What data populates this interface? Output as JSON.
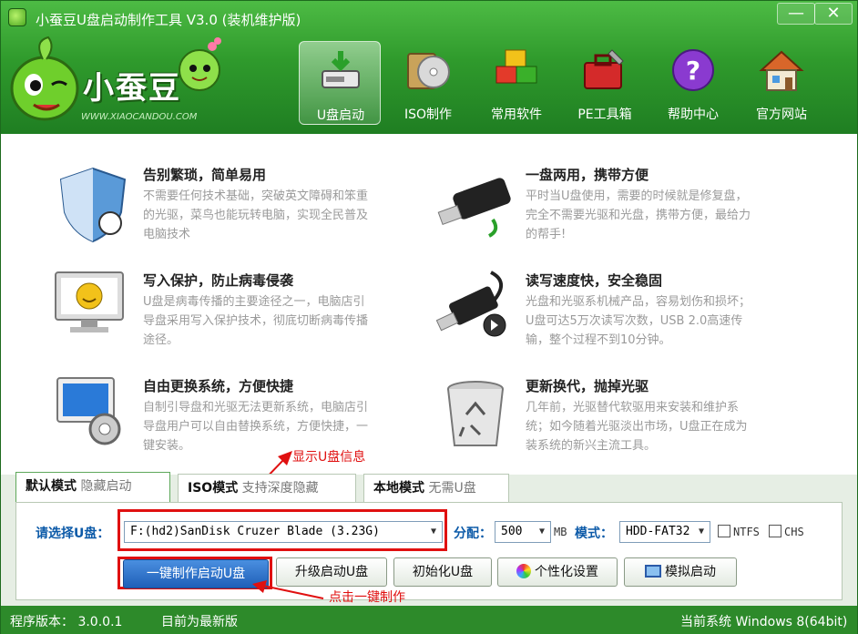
{
  "window": {
    "title": "小蚕豆U盘启动制作工具 V3.0 (装机维护版)",
    "minimize": "—",
    "close": "✕"
  },
  "logo": {
    "text": "小蚕豆",
    "url": "WWW.XIAOCANDOU.COM"
  },
  "nav": [
    {
      "label": "U盘启动",
      "icon": "usb-drive-icon"
    },
    {
      "label": "ISO制作",
      "icon": "iso-disc-icon"
    },
    {
      "label": "常用软件",
      "icon": "software-cubes-icon"
    },
    {
      "label": "PE工具箱",
      "icon": "toolbox-icon"
    },
    {
      "label": "帮助中心",
      "icon": "help-icon"
    },
    {
      "label": "官方网站",
      "icon": "home-icon"
    }
  ],
  "features": [
    {
      "title": "告别繁琐，简单易用",
      "desc": "不需要任何技术基础，突破英文障碍和笨重的光驱，菜鸟也能玩转电脑，实现全民普及电脑技术",
      "icon": "shield-icon"
    },
    {
      "title": "一盘两用，携带方便",
      "desc": "平时当U盘使用，需要的时候就是修复盘，完全不需要光驱和光盘，携带方便，最给力的帮手!",
      "icon": "usb-stick-icon"
    },
    {
      "title": "写入保护，防止病毒侵袭",
      "desc": "U盘是病毒传播的主要途径之一，电脑店引导盘采用写入保护技术，彻底切断病毒传播途径。",
      "icon": "monitor-smiley-icon"
    },
    {
      "title": "读写速度快，安全稳固",
      "desc": "光盘和光驱系机械产品，容易划伤和损坏；U盘可达5万次读写次数，USB 2.0高速传输，整个过程不到10分钟。",
      "icon": "usb-cable-icon"
    },
    {
      "title": "自由更换系统，方便快捷",
      "desc": "自制引导盘和光驱无法更新系统，电脑店引导盘用户可以自由替换系统，方便快捷，一键安装。",
      "icon": "computer-gear-icon"
    },
    {
      "title": "更新换代，抛掉光驱",
      "desc": "几年前，光驱替代软驱用来安装和维护系统；如今随着光驱淡出市场，U盘正在成为装系统的新兴主流工具。",
      "icon": "recycle-bin-icon"
    }
  ],
  "annotations": {
    "show_info": "显示U盘信息",
    "click_make": "点击一键制作"
  },
  "tabs": [
    {
      "main": "默认模式",
      "sub": "隐藏启动"
    },
    {
      "main": "ISO模式",
      "sub": "支持深度隐藏"
    },
    {
      "main": "本地模式",
      "sub": "无需U盘"
    }
  ],
  "controls": {
    "select_label": "请选择U盘：",
    "selected_disk": "F:(hd2)SanDisk Cruzer Blade (3.23G)",
    "partition_label": "分配：",
    "partition_value": "500",
    "partition_unit": "MB",
    "mode_label": "模式：",
    "mode_value": "HDD-FAT32",
    "ntfs": "NTFS",
    "chs": "CHS"
  },
  "buttons": {
    "make": "一键制作启动U盘",
    "upgrade": "升级启动U盘",
    "init": "初始化U盘",
    "personalize": "个性化设置",
    "simulate": "模拟启动"
  },
  "status": {
    "version": "程序版本： 3.0.0.1",
    "latest": "目前为最新版",
    "system": "当前系统 Windows 8(64bit)"
  }
}
